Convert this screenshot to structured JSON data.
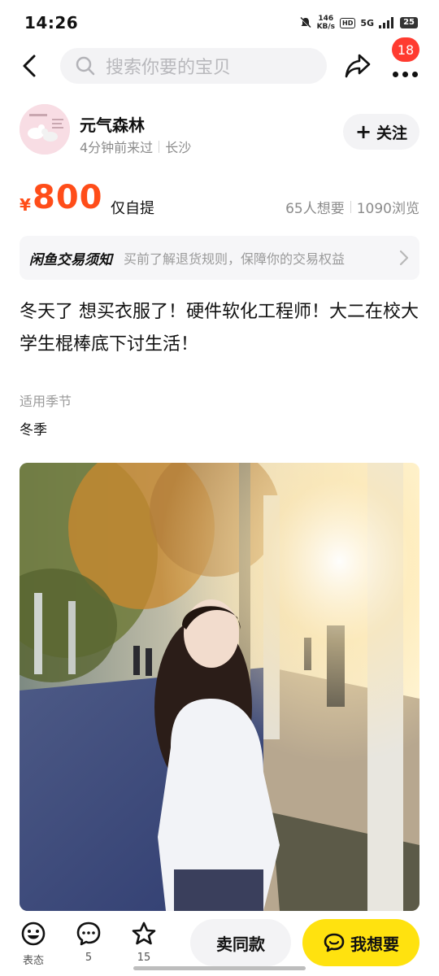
{
  "status_bar": {
    "time": "14:26",
    "net_speed_value": "146",
    "net_speed_unit": "KB/s",
    "hd_label": "HD",
    "network_label": "5G",
    "battery": "25"
  },
  "nav": {
    "search_placeholder": "搜索你要的宝贝",
    "message_count": "18"
  },
  "seller": {
    "name": "元气森林",
    "last_seen": "4分钟前来过",
    "location": "长沙",
    "follow_label": "关注"
  },
  "item": {
    "currency": "¥",
    "price": "800",
    "delivery": "仅自提",
    "wants": "65人想要",
    "views": "1090浏览",
    "description": "冬天了 想买衣服了！硬件软化工程师！大二在校大学生棍棒底下讨生活！",
    "attributes": [
      {
        "label": "适用季节",
        "value": "冬季"
      }
    ]
  },
  "notice": {
    "title": "闲鱼交易须知",
    "text": "买前了解退货规则，保障你的交易权益"
  },
  "bottom_bar": {
    "emoji_label": "表态",
    "comment_count": "5",
    "favorite_count": "15",
    "sell_same_label": "卖同款",
    "want_label": "我想要"
  },
  "colors": {
    "price": "#ff4d19",
    "want_button": "#ffe20f",
    "badge": "#ff3b30"
  }
}
